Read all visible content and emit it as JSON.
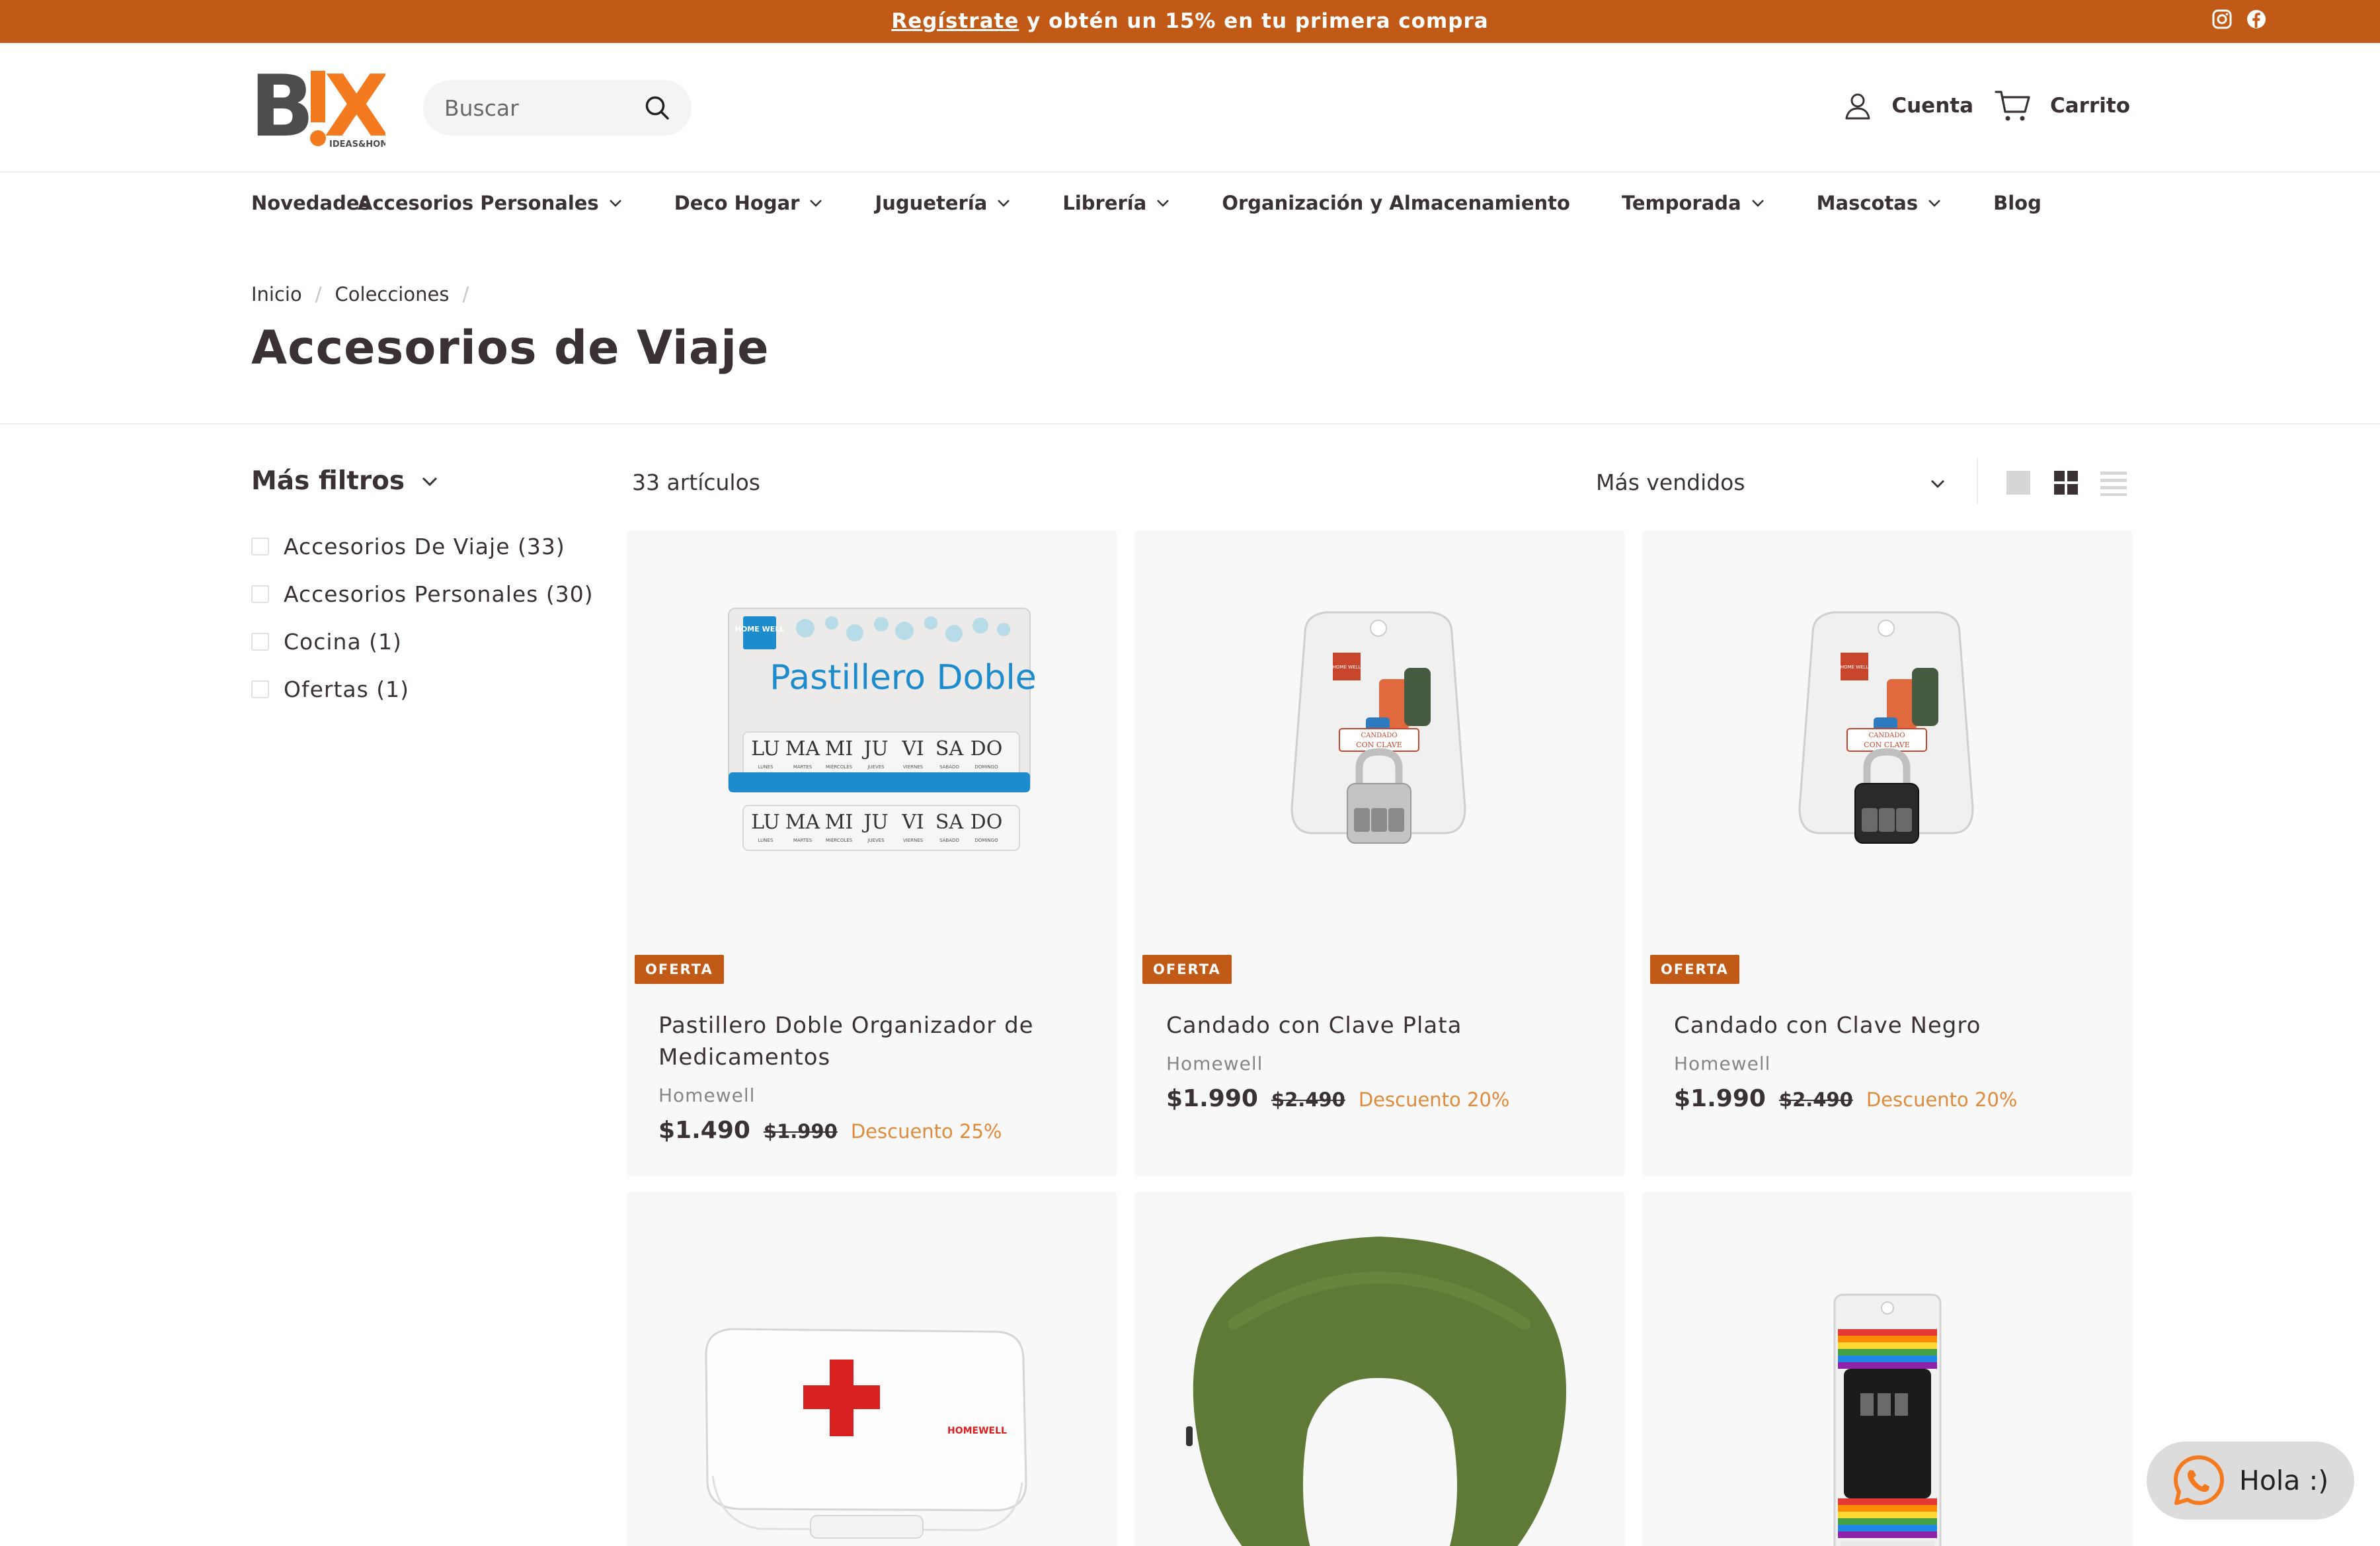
{
  "announcement": {
    "link_text": "Regístrate",
    "message": " y obtén un 15% en tu primera compra",
    "social_icons": [
      "instagram-icon",
      "facebook-icon"
    ]
  },
  "brand": {
    "logo_text": "BIX",
    "logo_tagline": "IDEAS&HOME",
    "accent_color": "#c25a17",
    "logo_orange": "#f47a20",
    "logo_gray": "#4d4d4d"
  },
  "header": {
    "search_placeholder": "Buscar",
    "account_label": "Cuenta",
    "cart_label": "Carrito"
  },
  "nav": {
    "items": [
      {
        "label": "Novedades",
        "dropdown": false
      },
      {
        "label": "Accesorios Personales",
        "dropdown": true
      },
      {
        "label": "Deco Hogar",
        "dropdown": true
      },
      {
        "label": "Juguetería",
        "dropdown": true
      },
      {
        "label": "Librería",
        "dropdown": true
      },
      {
        "label": "Organización y Almacenamiento",
        "dropdown": false
      },
      {
        "label": "Temporada",
        "dropdown": true
      },
      {
        "label": "Mascotas",
        "dropdown": true
      },
      {
        "label": "Blog",
        "dropdown": false
      }
    ]
  },
  "breadcrumb": [
    "Inicio",
    "Colecciones"
  ],
  "page": {
    "title": "Accesorios de Viaje"
  },
  "filters": {
    "heading": "Más filtros",
    "items": [
      {
        "label": "Accesorios De Viaje (33)"
      },
      {
        "label": "Accesorios Personales (30)"
      },
      {
        "label": "Cocina (1)"
      },
      {
        "label": "Ofertas (1)"
      }
    ]
  },
  "toolbar": {
    "count": "33 artículos",
    "sort_label": "Más vendidos",
    "view_icons": [
      "grid-large-icon",
      "grid-small-icon",
      "list-view-icon"
    ]
  },
  "products": [
    {
      "badge": "OFERTA",
      "title": "Pastillero Doble Organizador de Medicamentos",
      "vendor": "Homewell",
      "price": "$1.490",
      "was": "$1.990",
      "discount": "Descuento 25%",
      "image_text": {
        "brand": "HOME WELL",
        "heading": "Pastillero Doble",
        "days": [
          "LU",
          "MA",
          "MI",
          "JU",
          "VI",
          "SA",
          "DO"
        ],
        "day_names": [
          "LUNES",
          "MARTES",
          "MIÉRCOLES",
          "JUEVES",
          "VIERNES",
          "SÁBADO",
          "DOMINGO"
        ]
      }
    },
    {
      "badge": "OFERTA",
      "title": "Candado con Clave Plata",
      "vendor": "Homewell",
      "price": "$1.990",
      "was": "$2.490",
      "discount": "Descuento 20%",
      "image_text": {
        "brand": "HOME WELL",
        "line1": "CANDADO",
        "line2": "CON CLAVE"
      }
    },
    {
      "badge": "OFERTA",
      "title": "Candado con Clave Negro",
      "vendor": "Homewell",
      "price": "$1.990",
      "was": "$2.490",
      "discount": "Descuento 20%",
      "image_text": {
        "brand": "HOME WELL",
        "line1": "CANDADO",
        "line2": "CON CLAVE"
      }
    },
    {
      "image_text": {
        "brand": "HOMEWELL"
      }
    },
    {},
    {}
  ],
  "chat": {
    "label": "Hola :)"
  }
}
